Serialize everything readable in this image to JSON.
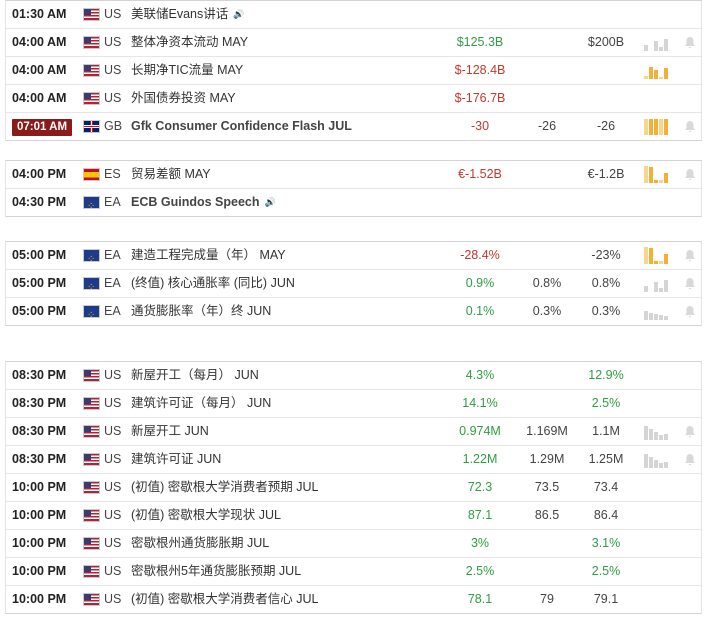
{
  "colors": {
    "negative": "#c0392b",
    "positive": "#2e9e3f",
    "neutral": "#333333",
    "current_time_badge": "#8b1a1a",
    "spark_gray": "#cfcfcf",
    "spark_orange": "#f2b134",
    "spark_orange_light": "#f7d48f"
  },
  "groups": [
    {
      "rows": [
        {
          "time": "01:30 AM",
          "flag": "us",
          "country": "US",
          "event": "美联储Evans讲话",
          "speech": true,
          "actual": "",
          "actual_tone": "neu",
          "forecast": "",
          "previous": "",
          "spark": "none",
          "alert": false
        },
        {
          "time": "04:00 AM",
          "flag": "us",
          "country": "US",
          "event": "整体净资本流动 MAY",
          "actual": "$125.3B",
          "actual_tone": "pos",
          "forecast": "",
          "previous": "$200B",
          "spark": "gray-mixed",
          "alert": true
        },
        {
          "time": "04:00 AM",
          "flag": "us",
          "country": "US",
          "event": "长期净TIC流量 MAY",
          "actual": "$-128.4B",
          "actual_tone": "neg",
          "forecast": "",
          "previous": "",
          "spark": "orange-mixed",
          "alert": false
        },
        {
          "time": "04:00 AM",
          "flag": "us",
          "country": "US",
          "event": "外国债券投资 MAY",
          "actual": "$-176.7B",
          "actual_tone": "neg",
          "forecast": "",
          "previous": "",
          "spark": "none",
          "alert": false
        },
        {
          "time": "07:01 AM",
          "current": true,
          "flag": "gb",
          "country": "GB",
          "event": "Gfk Consumer Confidence Flash JUL",
          "bold": true,
          "actual": "-30",
          "actual_tone": "neg",
          "forecast": "-26",
          "previous": "-26",
          "spark": "orange-full",
          "alert": true
        }
      ]
    },
    {
      "rows": [
        {
          "time": "04:00 PM",
          "flag": "es",
          "country": "ES",
          "event": "贸易差额 MAY",
          "actual": "€-1.52B",
          "actual_tone": "neg",
          "forecast": "",
          "previous": "€-1.2B",
          "spark": "orange-low",
          "alert": true
        },
        {
          "time": "04:30 PM",
          "flag": "ea",
          "country": "EA",
          "event": "ECB Guindos Speech",
          "bold": true,
          "speech": true,
          "actual": "",
          "actual_tone": "neu",
          "forecast": "",
          "previous": "",
          "spark": "none",
          "alert": false
        }
      ]
    },
    {
      "rows": [
        {
          "time": "05:00 PM",
          "flag": "ea",
          "country": "EA",
          "event": "建造工程完成量（年） MAY",
          "actual": "-28.4%",
          "actual_tone": "neg",
          "forecast": "",
          "previous": "-23%",
          "spark": "orange-low",
          "alert": true
        },
        {
          "time": "05:00 PM",
          "flag": "ea",
          "country": "EA",
          "event": "(终值) 核心通胀率 (同比) JUN",
          "actual": "0.9%",
          "actual_tone": "pos",
          "forecast": "0.8%",
          "previous": "0.8%",
          "spark": "gray-mixed",
          "alert": true
        },
        {
          "time": "05:00 PM",
          "flag": "ea",
          "country": "EA",
          "event": "通货膨胀率（年）终 JUN",
          "actual": "0.1%",
          "actual_tone": "pos",
          "forecast": "0.3%",
          "previous": "0.3%",
          "spark": "gray-low",
          "alert": true
        }
      ]
    },
    {
      "rows": [
        {
          "time": "08:30 PM",
          "flag": "us",
          "country": "US",
          "event": "新屋开工（每月） JUN",
          "actual": "4.3%",
          "actual_tone": "pos",
          "forecast": "",
          "previous": "12.9%",
          "previous_tone": "pos",
          "spark": "none",
          "alert": false
        },
        {
          "time": "08:30 PM",
          "flag": "us",
          "country": "US",
          "event": "建筑许可证（每月） JUN",
          "actual": "14.1%",
          "actual_tone": "pos",
          "forecast": "",
          "previous": "2.5%",
          "previous_tone": "pos",
          "spark": "none",
          "alert": false
        },
        {
          "time": "08:30 PM",
          "flag": "us",
          "country": "US",
          "event": "新屋开工 JUN",
          "actual": "0.974M",
          "actual_tone": "pos",
          "forecast": "1.169M",
          "previous": "1.1M",
          "spark": "gray-high",
          "alert": true
        },
        {
          "time": "08:30 PM",
          "flag": "us",
          "country": "US",
          "event": "建筑许可证 JUN",
          "actual": "1.22M",
          "actual_tone": "pos",
          "forecast": "1.29M",
          "previous": "1.25M",
          "spark": "gray-high",
          "alert": true
        },
        {
          "time": "10:00 PM",
          "flag": "us",
          "country": "US",
          "event": "(初值) 密歇根大学消费者预期 JUL",
          "actual": "72.3",
          "actual_tone": "pos",
          "forecast": "73.5",
          "previous": "73.4",
          "spark": "none",
          "alert": false
        },
        {
          "time": "10:00 PM",
          "flag": "us",
          "country": "US",
          "event": "(初值) 密歇根大学现状 JUL",
          "actual": "87.1",
          "actual_tone": "pos",
          "forecast": "86.5",
          "previous": "86.4",
          "spark": "none",
          "alert": false
        },
        {
          "time": "10:00 PM",
          "flag": "us",
          "country": "US",
          "event": "密歇根州通货膨胀期 JUL",
          "actual": "3%",
          "actual_tone": "pos",
          "forecast": "",
          "previous": "3.1%",
          "previous_tone": "pos",
          "spark": "none",
          "alert": false
        },
        {
          "time": "10:00 PM",
          "flag": "us",
          "country": "US",
          "event": "密歇根州5年通货膨胀预期 JUL",
          "actual": "2.5%",
          "actual_tone": "pos",
          "forecast": "",
          "previous": "2.5%",
          "previous_tone": "pos",
          "spark": "none",
          "alert": false
        },
        {
          "time": "10:00 PM",
          "flag": "us",
          "country": "US",
          "event": "(初值) 密歇根大学消费者信心 JUL",
          "actual": "78.1",
          "actual_tone": "pos",
          "forecast": "79",
          "previous": "79.1",
          "spark": "none",
          "alert": false
        }
      ]
    }
  ]
}
